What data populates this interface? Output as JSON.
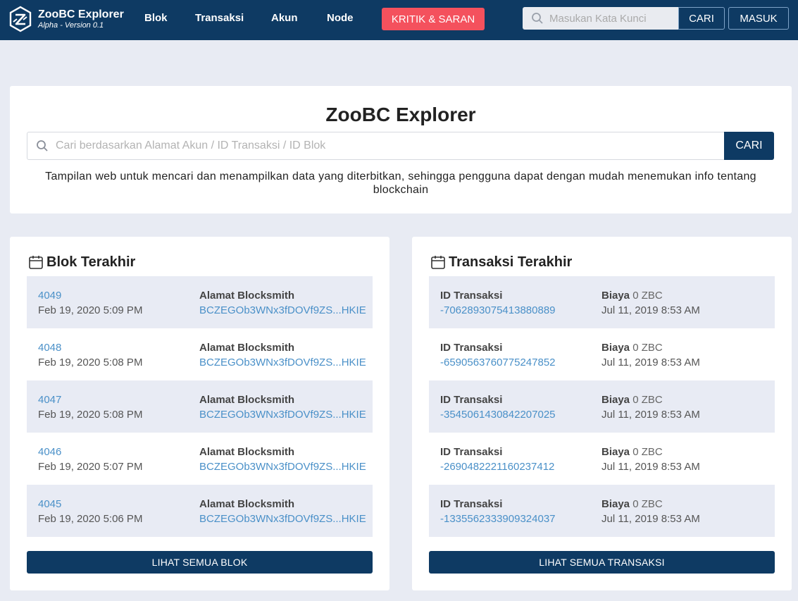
{
  "nav": {
    "brand_name": "ZooBC Explorer",
    "brand_version": "Alpha - Version 0.1",
    "links": [
      "Blok",
      "Transaksi",
      "Akun",
      "Node"
    ],
    "feedback": "KRITIK & SARAN",
    "search_placeholder": "Masukan Kata Kunci",
    "search_button": "CARI",
    "login": "MASUK"
  },
  "hero": {
    "title": "ZooBC Explorer",
    "search_placeholder": "Cari berdasarkan Alamat Akun / ID Transaksi / ID Blok",
    "search_button": "CARI",
    "description": "Tampilan web untuk mencari dan menampilkan data yang diterbitkan, sehingga pengguna dapat dengan mudah menemukan info tentang blockchain"
  },
  "blocks": {
    "title": "Blok Terakhir",
    "items": [
      {
        "height": "4049",
        "time": "Feb 19, 2020 5:09 PM",
        "label": "Alamat Blocksmith",
        "address": "BCZEGOb3WNx3fDOVf9ZS...HKIE"
      },
      {
        "height": "4048",
        "time": "Feb 19, 2020 5:08 PM",
        "label": "Alamat Blocksmith",
        "address": "BCZEGOb3WNx3fDOVf9ZS...HKIE"
      },
      {
        "height": "4047",
        "time": "Feb 19, 2020 5:08 PM",
        "label": "Alamat Blocksmith",
        "address": "BCZEGOb3WNx3fDOVf9ZS...HKIE"
      },
      {
        "height": "4046",
        "time": "Feb 19, 2020 5:07 PM",
        "label": "Alamat Blocksmith",
        "address": "BCZEGOb3WNx3fDOVf9ZS...HKIE"
      },
      {
        "height": "4045",
        "time": "Feb 19, 2020 5:06 PM",
        "label": "Alamat Blocksmith",
        "address": "BCZEGOb3WNx3fDOVf9ZS...HKIE"
      }
    ],
    "see_all": "LIHAT SEMUA BLOK"
  },
  "transactions": {
    "title": "Transaksi Terakhir",
    "items": [
      {
        "id_label": "ID Transaksi",
        "id": "-7062893075413880889",
        "fee_label": "Biaya",
        "fee": "0 ZBC",
        "time": "Jul 11, 2019 8:53 AM"
      },
      {
        "id_label": "ID Transaksi",
        "id": "-6590563760775247852",
        "fee_label": "Biaya",
        "fee": "0 ZBC",
        "time": "Jul 11, 2019 8:53 AM"
      },
      {
        "id_label": "ID Transaksi",
        "id": "-3545061430842207025",
        "fee_label": "Biaya",
        "fee": "0 ZBC",
        "time": "Jul 11, 2019 8:53 AM"
      },
      {
        "id_label": "ID Transaksi",
        "id": "-2690482221160237412",
        "fee_label": "Biaya",
        "fee": "0 ZBC",
        "time": "Jul 11, 2019 8:53 AM"
      },
      {
        "id_label": "ID Transaksi",
        "id": "-1335562333909324037",
        "fee_label": "Biaya",
        "fee": "0 ZBC",
        "time": "Jul 11, 2019 8:53 AM"
      }
    ],
    "see_all": "LIHAT SEMUA TRANSAKSI"
  },
  "colors": {
    "navbar": "#0e3a63",
    "feedback": "#f4515d",
    "link": "#4a90c8",
    "page_bg": "#e8ebf3"
  }
}
